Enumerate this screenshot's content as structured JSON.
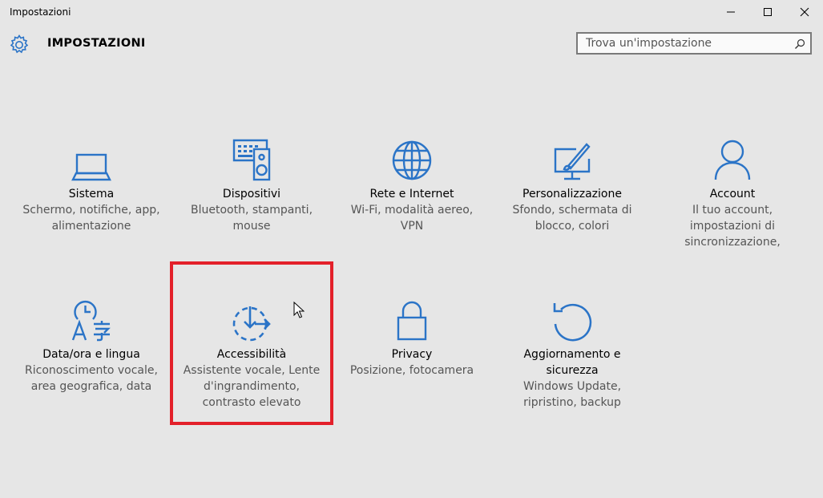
{
  "window": {
    "title": "Impostazioni",
    "minimize_glyph": "minimize-icon",
    "maximize_glyph": "maximize-icon",
    "close_glyph": "close-icon"
  },
  "header": {
    "title": "IMPOSTAZIONI",
    "icon": "gear-icon"
  },
  "search": {
    "placeholder": "Trova un'impostazione",
    "value": "",
    "icon": "search-icon"
  },
  "accent_color": "#2b74c7",
  "highlight_color": "#e3202a",
  "tiles": [
    {
      "icon": "laptop-icon",
      "name": "Sistema",
      "desc": [
        "Schermo, notifiche, app,",
        "alimentazione"
      ]
    },
    {
      "icon": "devices-icon",
      "name": "Dispositivi",
      "desc": [
        "Bluetooth, stampanti,",
        "mouse"
      ]
    },
    {
      "icon": "globe-icon",
      "name": "Rete e Internet",
      "desc": [
        "Wi-Fi, modalità aereo,",
        "VPN"
      ]
    },
    {
      "icon": "personalization-icon",
      "name": "Personalizzazione",
      "desc": [
        "Sfondo, schermata di",
        "blocco, colori"
      ]
    },
    {
      "icon": "user-icon",
      "name": "Account",
      "desc": [
        "Il tuo account,",
        "impostazioni di",
        "sincronizzazione,"
      ]
    },
    {
      "icon": "time-language-icon",
      "name": "Data/ora e lingua",
      "desc": [
        "Riconoscimento vocale,",
        "area geografica, data"
      ]
    },
    {
      "icon": "ease-of-access-icon",
      "name": "Accessibilità",
      "desc": [
        "Assistente vocale, Lente",
        "d'ingrandimento,",
        "contrasto elevato"
      ]
    },
    {
      "icon": "lock-icon",
      "name": "Privacy",
      "desc": [
        "Posizione, fotocamera"
      ]
    },
    {
      "icon": "update-icon",
      "name": "Aggiornamento e sicurezza",
      "name_lines": [
        "Aggiornamento e",
        "sicurezza"
      ],
      "desc": [
        "Windows Update,",
        "ripristino, backup"
      ]
    }
  ]
}
